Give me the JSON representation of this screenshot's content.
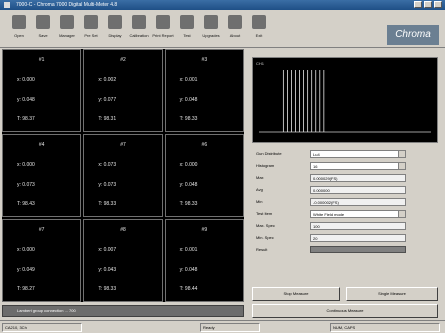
{
  "window": {
    "title": "7000-C - Chroma 7000 Digital Multi-Meter 4.8"
  },
  "toolbar": {
    "items": [
      {
        "label": "Open",
        "icon": "open-icon"
      },
      {
        "label": "Save",
        "icon": "save-icon"
      },
      {
        "label": "Manager",
        "icon": "manager-icon"
      },
      {
        "label": "Pre Set",
        "icon": "preset-icon"
      },
      {
        "label": "Display",
        "icon": "display-icon"
      },
      {
        "label": "Calibration",
        "icon": "calibration-icon"
      },
      {
        "label": "Print Report",
        "icon": "print-icon"
      },
      {
        "label": "Test",
        "icon": "test-icon"
      },
      {
        "label": "Upgrades",
        "icon": "upgrade-icon"
      },
      {
        "label": "About",
        "icon": "about-icon"
      },
      {
        "label": "Exit",
        "icon": "exit-icon"
      }
    ],
    "brand": "Chroma"
  },
  "channels": [
    {
      "name": "#1",
      "v1": "x: 0.000",
      "v2": "y: 0.048",
      "v3": "T: 98.37"
    },
    {
      "name": "#2",
      "v1": "x: 0.002",
      "v2": "y: 0.077",
      "v3": "T: 98.31"
    },
    {
      "name": "#3",
      "v1": "x: 0.001",
      "v2": "y: 0.048",
      "v3": "T: 98.33"
    },
    {
      "name": "#4",
      "v1": "x: 0.000",
      "v2": "y: 0.073",
      "v3": "T: 98.43"
    },
    {
      "name": "#7",
      "v1": "x: 0.073",
      "v2": "y: 0.073",
      "v3": "T: 98.33"
    },
    {
      "name": "#6",
      "v1": "x: 0.000",
      "v2": "y: 0.048",
      "v3": "T: 98.33"
    },
    {
      "name": "#7",
      "v1": "x: 0.000",
      "v2": "y: 0.049",
      "v3": "T: 98.27"
    },
    {
      "name": "#8",
      "v1": "x: 0.007",
      "v2": "y: 0.043",
      "v3": "T: 98.33"
    },
    {
      "name": "#9",
      "v1": "x: 0.001",
      "v2": "y: 0.048",
      "v3": "T: 98.44"
    }
  ],
  "left_status": "Lambert group connection ... 700",
  "scope": {
    "label": "CH1",
    "pulses": [
      0.3,
      0.34,
      0.38,
      0.42,
      0.46,
      0.5,
      0.54,
      0.58,
      0.62,
      0.66,
      0.7
    ]
  },
  "form": {
    "rows": [
      {
        "label": "Gun Distribute",
        "value": "Lu4",
        "spin": true
      },
      {
        "label": "Histogram",
        "value": "16",
        "spin": true
      },
      {
        "label": "Max",
        "value": "0.000029(FS)"
      },
      {
        "label": "Avg",
        "value": "0.000000"
      },
      {
        "label": "Min",
        "value": "-0.000002(FS)"
      },
      {
        "label": "Test Item",
        "value": "White Field mode",
        "spin": true
      },
      {
        "label": "Max. Spec",
        "value": "100"
      },
      {
        "label": "Min. Spec",
        "value": "20"
      },
      {
        "label": "Result",
        "value": ""
      }
    ]
  },
  "buttons": {
    "stop": "Stop Measure",
    "single": "Single Measure",
    "continuous": "Continuous Measure"
  },
  "statusbar": {
    "left": "CA210, 3Ch",
    "mid": "Ready",
    "right": "NUM, CAPS"
  },
  "colors": {
    "brand_bg": "#6b7f92",
    "grid_bg": "#000000",
    "title_bg": "#2a5f96"
  }
}
